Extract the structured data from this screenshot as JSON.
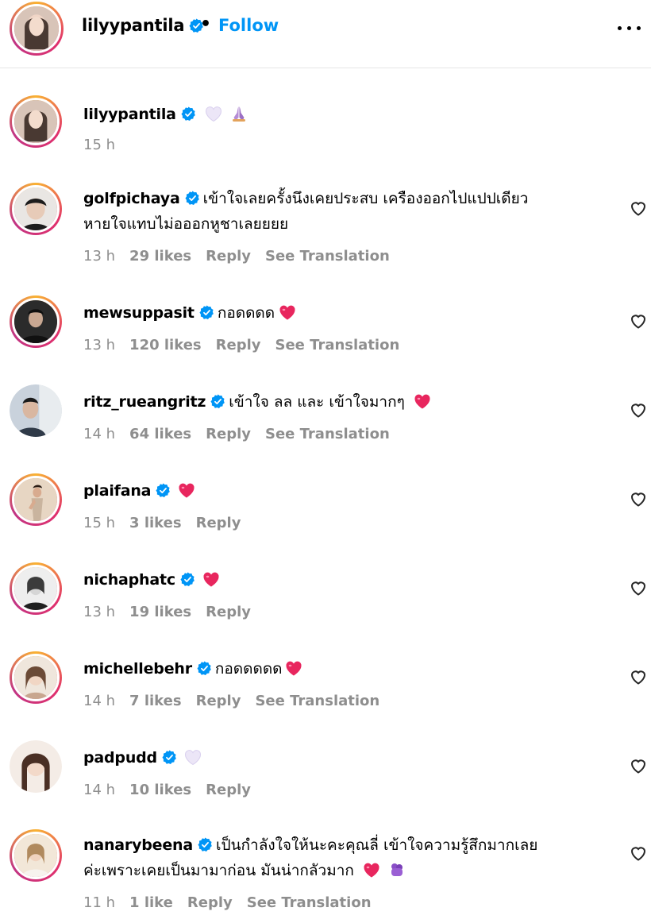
{
  "header": {
    "username": "lilyypantila",
    "separator": "•",
    "follow_label": "Follow",
    "verified_icon": "verified-badge-icon",
    "more_icon": "more-options-icon"
  },
  "colors": {
    "accent": "#0095f6",
    "meta_gray": "#8e8e8e",
    "heart_red": "#e8265e",
    "light_heart": "#e6e0f5"
  },
  "caption": {
    "username": "lilyypantila",
    "emojis": [
      "white-heart-icon",
      "praying-hands-icon"
    ],
    "time": "15 h"
  },
  "comments": [
    {
      "username": "golfpichaya",
      "text_line1": "เข้าใจเลยครั้งนึงเคยประสบ เครืองออกไปแปปเดียว",
      "text_line2": "หายใจแทบไม่อออกหูชาเลยยยย",
      "time": "13 h",
      "likes": "29 likes",
      "reply": "Reply",
      "translate": "See Translation"
    },
    {
      "username": "mewsuppasit",
      "text_line1": "กอดดดด",
      "emoji": "red-heart-icon",
      "time": "13 h",
      "likes": "120 likes",
      "reply": "Reply",
      "translate": "See Translation"
    },
    {
      "username": "ritz_rueangritz",
      "text_line1": "เข้าใจ ลล และ เข้าใจมากๆ",
      "emoji": "red-heart-icon",
      "time": "14 h",
      "likes": "64 likes",
      "reply": "Reply",
      "translate": "See Translation"
    },
    {
      "username": "plaifana",
      "emoji": "red-heart-icon",
      "time": "15 h",
      "likes": "3 likes",
      "reply": "Reply"
    },
    {
      "username": "nichaphatc",
      "emoji": "red-heart-icon",
      "time": "13 h",
      "likes": "19 likes",
      "reply": "Reply"
    },
    {
      "username": "michellebehr",
      "text_line1": "กอดดดดด",
      "emoji": "red-heart-icon",
      "time": "14 h",
      "likes": "7 likes",
      "reply": "Reply",
      "translate": "See Translation"
    },
    {
      "username": "padpudd",
      "emoji": "white-heart-icon",
      "time": "14 h",
      "likes": "10 likes",
      "reply": "Reply"
    },
    {
      "username": "nanarybeena",
      "text_line1": "เป็นกำลังใจให้นะคะคุณลี่ เข้าใจความรู้สึกมากเลย",
      "text_line2": "ค่ะเพราะเคยเป็นมามาก่อน มันน่ากลัวมาก",
      "emoji": "red-heart-icon",
      "emoji2": "purple-hands-icon",
      "time": "11 h",
      "likes": "1 like",
      "reply": "Reply",
      "translate": "See Translation"
    }
  ]
}
